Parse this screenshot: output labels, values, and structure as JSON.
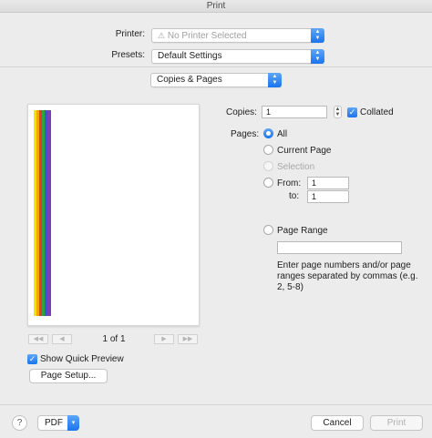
{
  "window": {
    "title": "Print"
  },
  "printer": {
    "label": "Printer:",
    "value": "No Printer Selected",
    "warning_icon": "warning-icon"
  },
  "presets": {
    "label": "Presets:",
    "value": "Default Settings"
  },
  "section_popup": {
    "value": "Copies & Pages"
  },
  "preview": {
    "page_counter": "1 of 1",
    "stripe_colors": [
      "#f0e500",
      "#f5a500",
      "#e23a2e",
      "#2ea43c",
      "#3a55d6",
      "#7a3fb4"
    ]
  },
  "copies": {
    "label": "Copies:",
    "value": "1",
    "collated_label": "Collated",
    "collated_checked": true
  },
  "pages": {
    "label": "Pages:",
    "options": {
      "all": "All",
      "current_page": "Current Page",
      "selection": "Selection",
      "from": "From:",
      "to": "to:",
      "page_range": "Page Range"
    },
    "from_value": "1",
    "to_value": "1",
    "range_hint": "Enter page numbers and/or page ranges separated by commas (e.g. 2, 5-8)",
    "range_value": ""
  },
  "quick_preview": {
    "label": "Show Quick Preview",
    "checked": true
  },
  "page_setup": {
    "label": "Page Setup..."
  },
  "footer": {
    "help": "?",
    "pdf": "PDF",
    "cancel": "Cancel",
    "print": "Print"
  }
}
